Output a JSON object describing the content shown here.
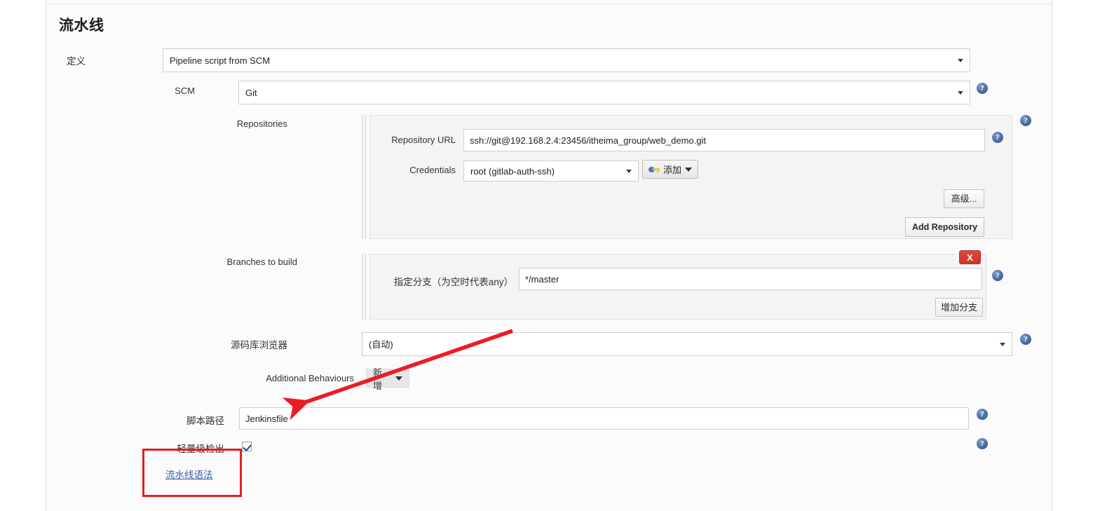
{
  "section": {
    "title": "流水线"
  },
  "definition": {
    "label": "定义",
    "value": "Pipeline script from SCM"
  },
  "scm": {
    "label": "SCM",
    "value": "Git"
  },
  "repositories": {
    "label": "Repositories",
    "repository_url": {
      "label": "Repository URL",
      "value": "ssh://git@192.168.2.4:23456/itheima_group/web_demo.git"
    },
    "credentials": {
      "label": "Credentials",
      "value": "root (gitlab-auth-ssh)",
      "add_button": "添加"
    },
    "advanced_button": "高级...",
    "add_repository_button": "Add Repository"
  },
  "branches": {
    "label": "Branches to build",
    "specifier": {
      "label": "指定分支（为空时代表any）",
      "value": "*/master"
    },
    "delete_button": "X",
    "add_branch_button": "增加分支"
  },
  "repository_browser": {
    "label": "源码库浏览器",
    "value": "(自动)"
  },
  "additional_behaviours": {
    "label": "Additional Behaviours",
    "add_button": "新增"
  },
  "script_path": {
    "label": "脚本路径",
    "value": "Jenkinsfile"
  },
  "lightweight_checkout": {
    "label": "轻量级检出",
    "checked": true
  },
  "pipeline_syntax_link": "流水线语法",
  "help_icon": "?",
  "colors": {
    "annotation_red": "#e02020",
    "help_blue": "#4a6ea5",
    "link_blue": "#3b5fa8",
    "delete_red": "#c9362d",
    "panel_bg": "#fbfbfb",
    "block_bg": "#f4f4f4"
  }
}
